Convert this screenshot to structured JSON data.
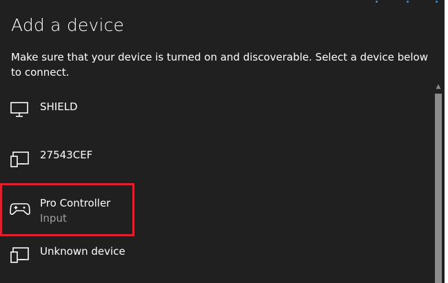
{
  "dialog": {
    "title": "Add a device",
    "description": "Make sure that your device is turned on and discoverable. Select a device below to connect."
  },
  "devices": [
    {
      "name": "SHIELD",
      "type": "",
      "icon": "monitor-icon"
    },
    {
      "name": "27543CEF",
      "type": "",
      "icon": "display-device-icon"
    },
    {
      "name": "Pro Controller",
      "type": "Input",
      "icon": "gamepad-icon",
      "highlighted": true
    },
    {
      "name": "Unknown device",
      "type": "",
      "icon": "display-device-icon"
    }
  ],
  "colors": {
    "background": "#202020",
    "text": "#ffffff",
    "secondary_text": "#a0a0a0",
    "highlight_border": "#e0202e",
    "accent": "#3a8ee6",
    "scrollbar": "#8c8c8c"
  }
}
